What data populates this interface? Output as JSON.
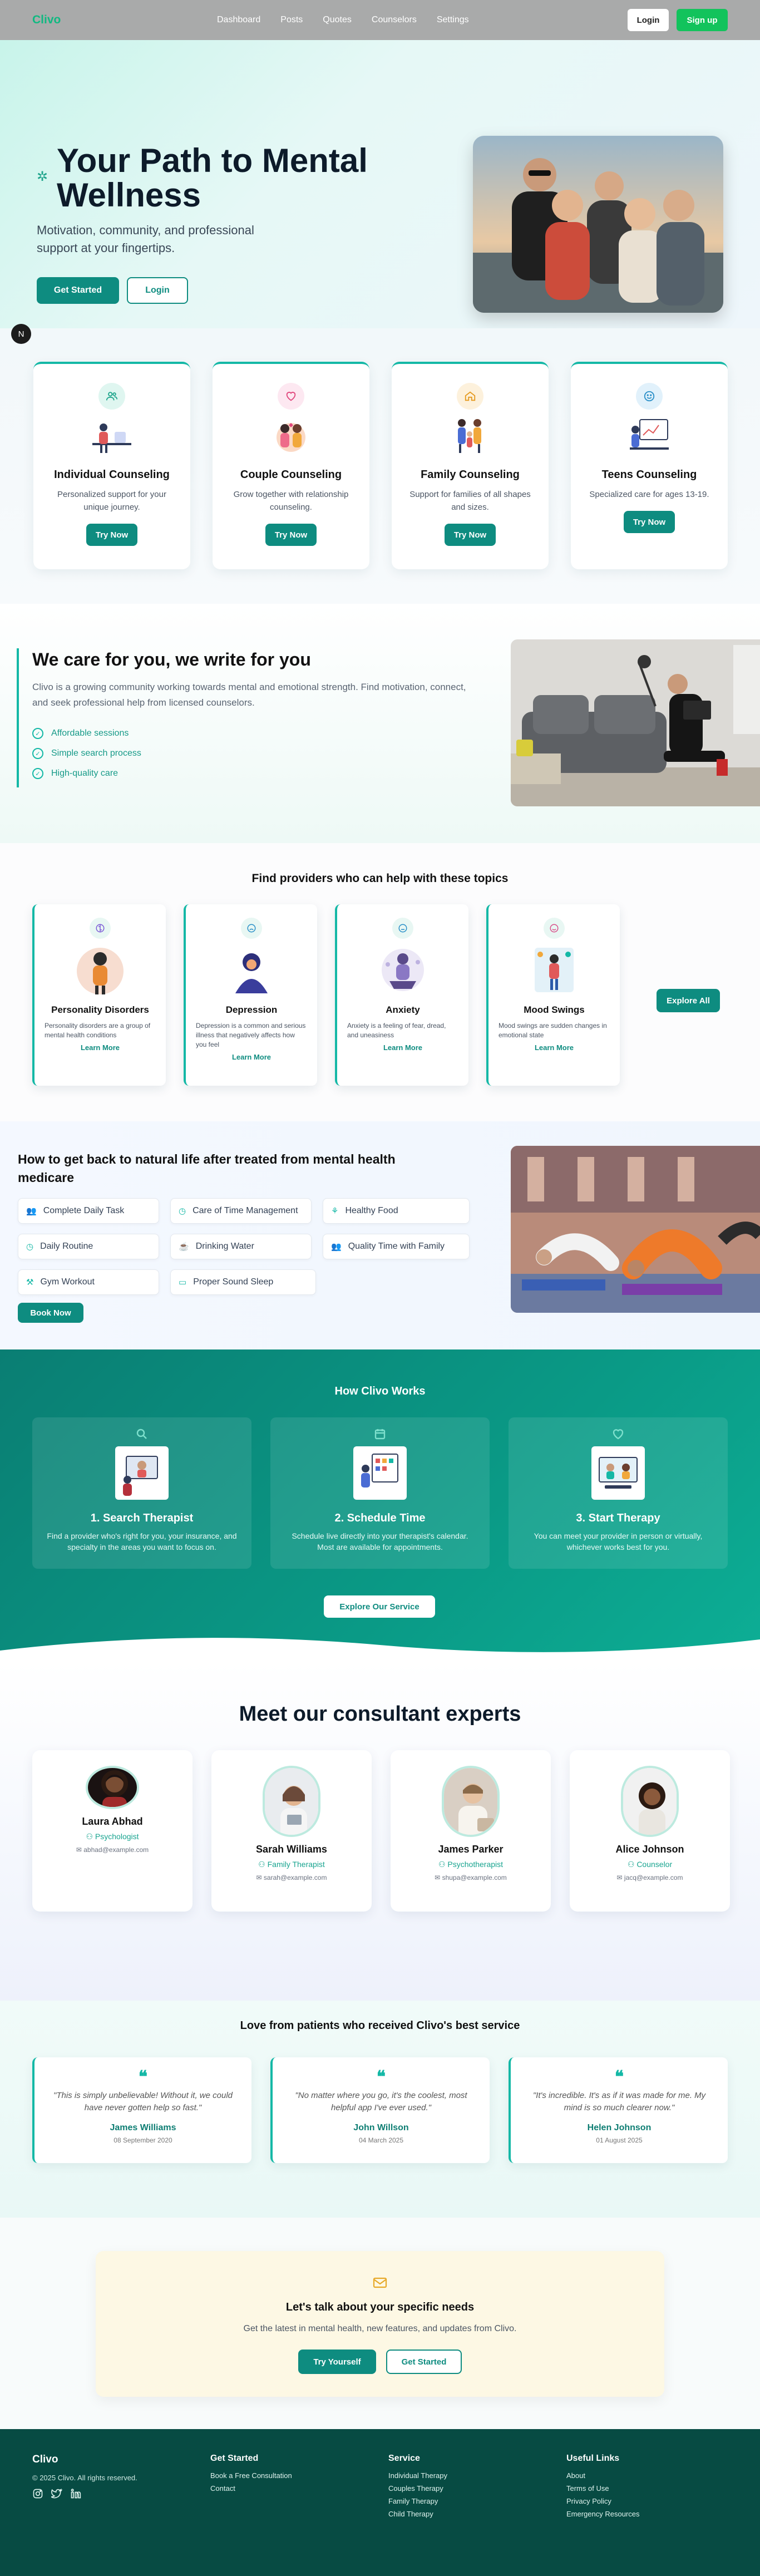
{
  "nav": {
    "brand": "Clivo",
    "links": [
      "Dashboard",
      "Posts",
      "Quotes",
      "Counselors",
      "Settings"
    ],
    "login": "Login",
    "signup": "Sign up"
  },
  "hero": {
    "title": "Your Path to Mental Wellness",
    "subtitle": "Motivation, community, and professional support at your fingertips.",
    "primary_button": "Get Started",
    "secondary_button": "Login",
    "avatar_letter": "N"
  },
  "services": [
    {
      "title": "Individual Counseling",
      "desc": "Personalized support for your unique journey.",
      "button": "Try Now",
      "icon": "users-icon"
    },
    {
      "title": "Couple Counseling",
      "desc": "Grow together with relationship counseling.",
      "button": "Try Now",
      "icon": "heart-icon"
    },
    {
      "title": "Family Counseling",
      "desc": "Support for families of all shapes and sizes.",
      "button": "Try Now",
      "icon": "home-icon"
    },
    {
      "title": "Teens Counseling",
      "desc": "Specialized care for ages 13-19.",
      "button": "Try Now",
      "icon": "smile-icon"
    }
  ],
  "care": {
    "title": "We care for you, we write for you",
    "desc": "Clivo is a growing community working towards mental and emotional strength. Find motivation, connect, and seek professional help from licensed counselors.",
    "items": [
      "Affordable sessions",
      "Simple search process",
      "High-quality care"
    ]
  },
  "topics": {
    "title": "Find providers who can help with these topics",
    "cards": [
      {
        "title": "Personality Disorders",
        "desc": "Personality disorders are a group of mental health conditions",
        "link": "Learn More"
      },
      {
        "title": "Depression",
        "desc": "Depression is a common and serious illness that negatively affects how you feel",
        "link": "Learn More"
      },
      {
        "title": "Anxiety",
        "desc": "Anxiety is a feeling of fear, dread, and uneasiness",
        "link": "Learn More"
      },
      {
        "title": "Mood Swings",
        "desc": "Mood swings are sudden changes in emotional state",
        "link": "Learn More"
      }
    ],
    "explore": "Explore All"
  },
  "natural": {
    "title": "How to get back to natural life after treated from mental health medicare",
    "items": [
      "Complete Daily Task",
      "Care of Time Management",
      "Healthy Food",
      "Daily Routine",
      "Drinking Water",
      "Quality Time with Family",
      "Gym Workout",
      "Proper Sound Sleep"
    ],
    "button": "Book Now"
  },
  "how": {
    "title": "How Clivo Works",
    "steps": [
      {
        "title": "1. Search Therapist",
        "desc": "Find a provider who's right for you, your insurance, and specialty in the areas you want to focus on."
      },
      {
        "title": "2. Schedule Time",
        "desc": "Schedule live directly into your therapist's calendar. Most are available for appointments."
      },
      {
        "title": "3. Start Therapy",
        "desc": "You can meet your provider in person or virtually, whichever works best for you."
      }
    ],
    "button": "Explore Our Service"
  },
  "experts": {
    "title": "Meet our consultant experts",
    "people": [
      {
        "name": "Laura Abhad",
        "role": "Psychologist",
        "email": "abhad@example.com"
      },
      {
        "name": "Sarah Williams",
        "role": "Family Therapist",
        "email": "sarah@example.com"
      },
      {
        "name": "James Parker",
        "role": "Psychotherapist",
        "email": "shupa@example.com"
      },
      {
        "name": "Alice Johnson",
        "role": "Counselor",
        "email": "jacq@example.com"
      }
    ]
  },
  "testimonials": {
    "title": "Love from patients who received Clivo's best service",
    "items": [
      {
        "quote": "\"This is simply unbelievable! Without it, we could have never gotten help so fast.\"",
        "name": "James Williams",
        "date": "08 September 2020"
      },
      {
        "quote": "\"No matter where you go, it's the coolest, most helpful app I've ever used.\"",
        "name": "John Willson",
        "date": "04 March 2025"
      },
      {
        "quote": "\"It's incredible. It's as if it was made for me. My mind is so much clearer now.\"",
        "name": "Helen Johnson",
        "date": "01 August 2025"
      }
    ]
  },
  "talk": {
    "title": "Let's talk about your specific needs",
    "desc": "Get the latest in mental health, new features, and updates from Clivo.",
    "primary": "Try Yourself",
    "secondary": "Get Started"
  },
  "footer": {
    "brand": "Clivo",
    "copy": "© 2025 Clivo. All rights reserved.",
    "columns": [
      {
        "title": "Get Started",
        "links": [
          "Book a Free Consultation",
          "Contact"
        ]
      },
      {
        "title": "Service",
        "links": [
          "Individual Therapy",
          "Couples Therapy",
          "Family Therapy",
          "Child Therapy"
        ]
      },
      {
        "title": "Useful Links",
        "links": [
          "About",
          "Terms of Use",
          "Privacy Policy",
          "Emergency Resources"
        ]
      }
    ]
  },
  "colors": {
    "brand": "#10b981",
    "teal": "#0e8c80",
    "accent": "#14b8a6",
    "footer": "#074b43"
  }
}
